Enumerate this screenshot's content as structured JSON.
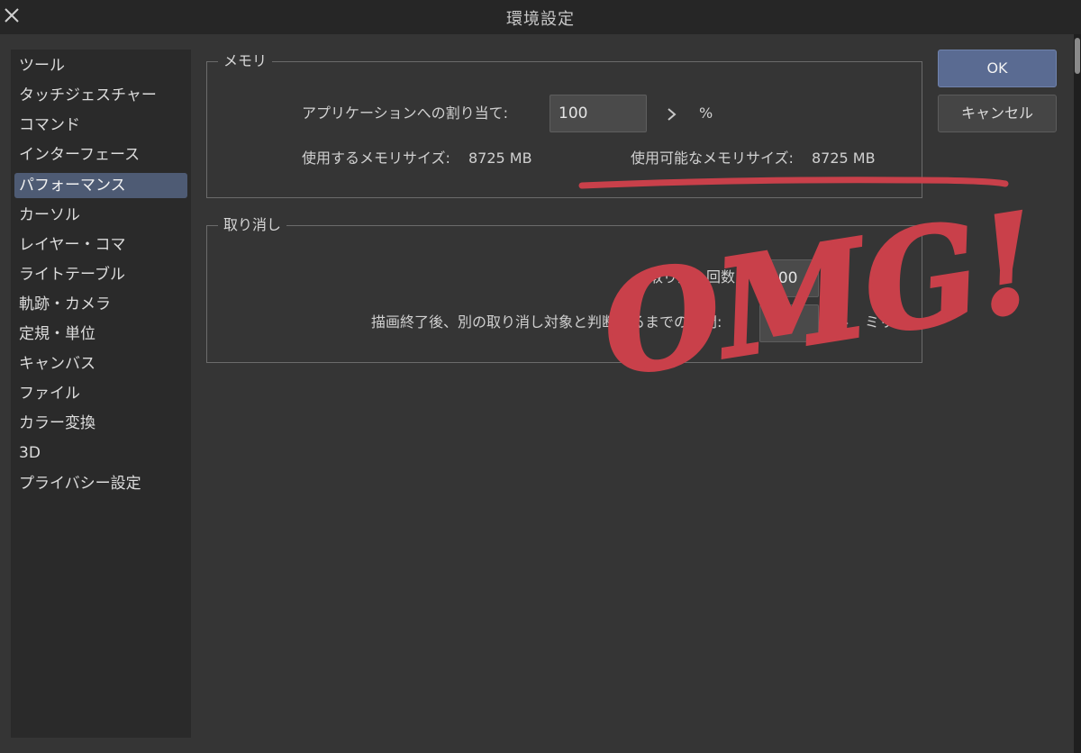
{
  "window": {
    "title": "環境設定"
  },
  "sidebar": {
    "items": [
      {
        "label": "ツール"
      },
      {
        "label": "タッチジェスチャー"
      },
      {
        "label": "コマンド"
      },
      {
        "label": "インターフェース"
      },
      {
        "label": "パフォーマンス",
        "selected": true
      },
      {
        "label": "カーソル"
      },
      {
        "label": "レイヤー・コマ"
      },
      {
        "label": "ライトテーブル"
      },
      {
        "label": "軌跡・カメラ"
      },
      {
        "label": "定規・単位"
      },
      {
        "label": "キャンバス"
      },
      {
        "label": "ファイル"
      },
      {
        "label": "カラー変換"
      },
      {
        "label": "3D"
      },
      {
        "label": "プライバシー設定"
      }
    ]
  },
  "memory": {
    "legend": "メモリ",
    "alloc_label": "アプリケーションへの割り当て:",
    "alloc_value": "100",
    "alloc_unit": "%",
    "used_label": "使用するメモリサイズ:",
    "used_value": "8725 MB",
    "available_label": "使用可能なメモリサイズ:",
    "available_value": "8725 MB"
  },
  "undo": {
    "legend": "取り消し",
    "count_label": "取り消し回数:",
    "count_value": "200",
    "interval_label": "描画終了後、別の取り消し対象と判断するまでの時間:",
    "interval_value": "0",
    "interval_unit": "ミリ秒"
  },
  "buttons": {
    "ok": "OK",
    "cancel": "キャンセル"
  },
  "annotation": {
    "text": "OMG!",
    "color": "#c9404a"
  },
  "colors": {
    "accent": "#5a6b92",
    "selected": "#4e5b74"
  }
}
